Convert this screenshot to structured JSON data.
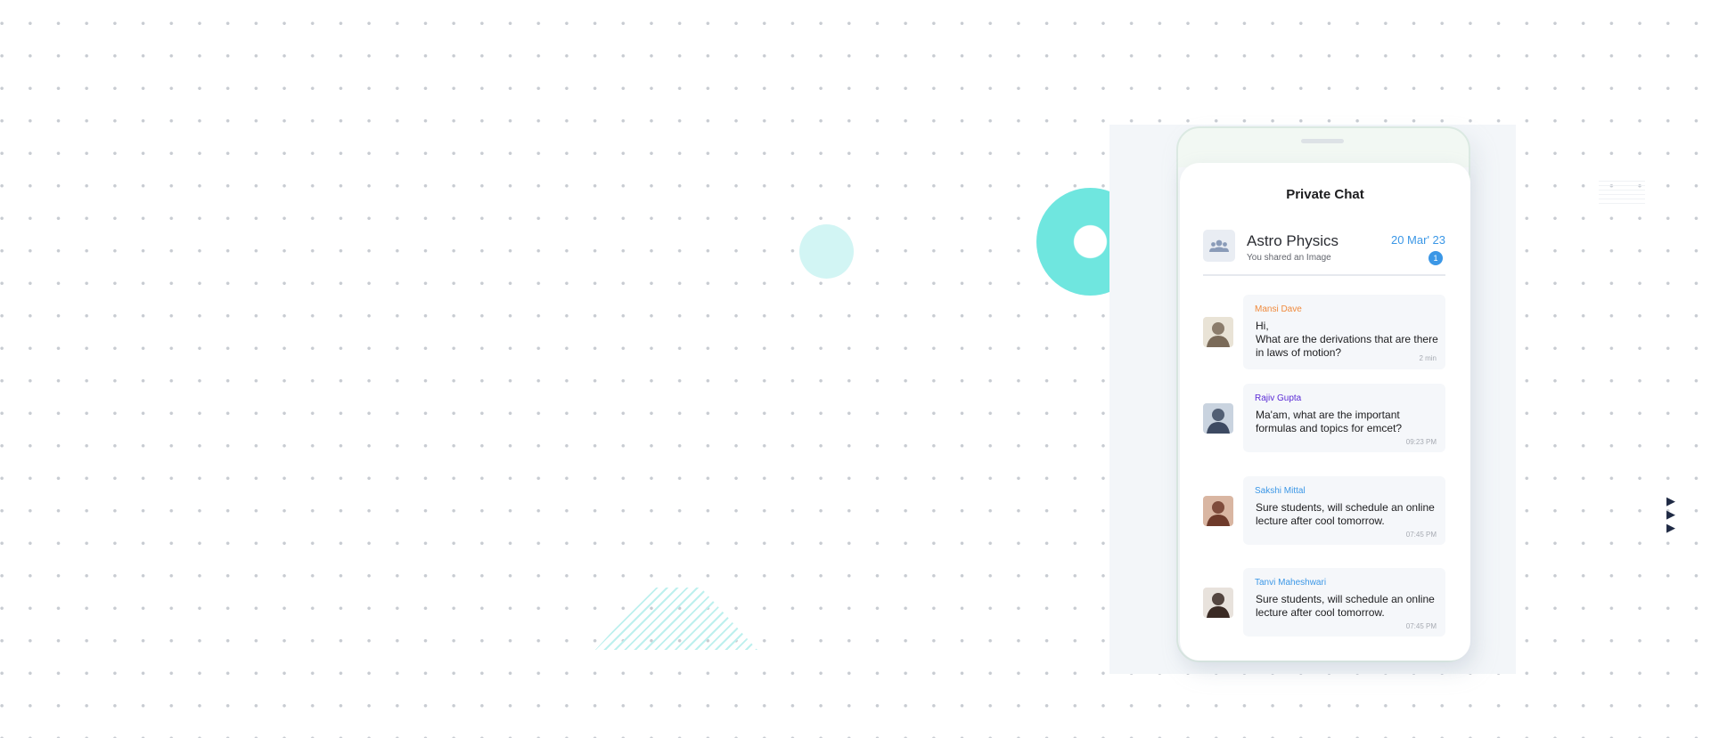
{
  "chat": {
    "title": "Private Chat",
    "group": {
      "name": "Astro Physics",
      "subtitle": "You shared an Image",
      "date": "20 Mar' 23",
      "unread": "1",
      "icon": "group-icon"
    },
    "messages": [
      {
        "sender": "Mansi Dave",
        "sender_color": "#f08a3c",
        "text": "Hi,\nWhat are the derivations that are there in laws of motion?",
        "time": "2 min",
        "avatar_colors": [
          "#e9e3d6",
          "#7a6a58"
        ]
      },
      {
        "sender": "Rajiv Gupta",
        "sender_color": "#5b2bd6",
        "text": "Ma'am, what are the important formulas and topics for emcet?",
        "time": "09:23 PM",
        "avatar_colors": [
          "#c9d3df",
          "#3d4a62"
        ]
      },
      {
        "sender": "Sakshi Mittal",
        "sender_color": "#3b97e6",
        "text": "Sure students, will schedule an online lecture after cool tomorrow.",
        "time": "07:45 PM",
        "avatar_colors": [
          "#d9b6a2",
          "#6e3a2a"
        ]
      },
      {
        "sender": "Tanvi Maheshwari",
        "sender_color": "#3b97e6",
        "text": "Sure students, will schedule an online lecture after cool tomorrow.",
        "time": "07:45 PM",
        "avatar_colors": [
          "#e8e2dc",
          "#3a2a24"
        ]
      }
    ]
  },
  "decor": {
    "accent": "#6fe6df",
    "arrow_icon": "play-arrow-icon"
  }
}
